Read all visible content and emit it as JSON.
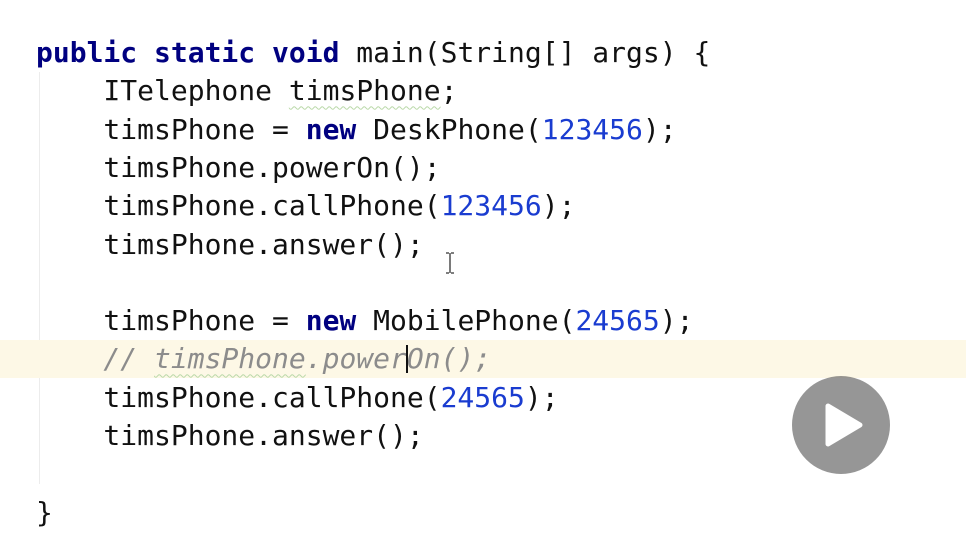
{
  "editor": {
    "lines": [
      {
        "tokens": [
          {
            "t": "public static void",
            "c": "kw"
          },
          {
            "t": " main(String[] args) {",
            "c": "plain"
          }
        ]
      },
      {
        "tokens": [
          {
            "t": "    ITelephone ",
            "c": "plain"
          },
          {
            "t": "timsPhone",
            "c": "plain",
            "u": true
          },
          {
            "t": ";",
            "c": "plain"
          }
        ]
      },
      {
        "tokens": [
          {
            "t": "    timsPhone = ",
            "c": "plain"
          },
          {
            "t": "new",
            "c": "kw"
          },
          {
            "t": " DeskPhone(",
            "c": "plain"
          },
          {
            "t": "123456",
            "c": "num"
          },
          {
            "t": ");",
            "c": "plain"
          }
        ]
      },
      {
        "tokens": [
          {
            "t": "    timsPhone.powerOn();",
            "c": "plain"
          }
        ]
      },
      {
        "tokens": [
          {
            "t": "    timsPhone.callPhone(",
            "c": "plain"
          },
          {
            "t": "123456",
            "c": "num"
          },
          {
            "t": ");",
            "c": "plain"
          }
        ]
      },
      {
        "tokens": [
          {
            "t": "    timsPhone.answer();",
            "c": "plain"
          }
        ]
      },
      {
        "tokens": []
      },
      {
        "tokens": [
          {
            "t": "    timsPhone = ",
            "c": "plain"
          },
          {
            "t": "new",
            "c": "kw"
          },
          {
            "t": " MobilePhone(",
            "c": "plain"
          },
          {
            "t": "24565",
            "c": "num"
          },
          {
            "t": ");",
            "c": "plain"
          }
        ]
      },
      {
        "current": true,
        "tokens": [
          {
            "t": "    // ",
            "c": "comment"
          },
          {
            "t": "timsPhone",
            "c": "comment",
            "u": true
          },
          {
            "t": ".power",
            "c": "comment"
          },
          {
            "caret": true
          },
          {
            "t": "On();",
            "c": "comment"
          }
        ]
      },
      {
        "tokens": [
          {
            "t": "    timsPhone.callPhone(",
            "c": "plain"
          },
          {
            "t": "24565",
            "c": "num"
          },
          {
            "t": ");",
            "c": "plain"
          }
        ]
      },
      {
        "tokens": [
          {
            "t": "    timsPhone.answer();",
            "c": "plain"
          }
        ]
      },
      {
        "tokens": []
      },
      {
        "tokens": [
          {
            "t": "}",
            "c": "plain"
          }
        ]
      }
    ]
  },
  "overlay": {
    "play_icon": "play-icon",
    "cursor_icon": "text-cursor-icon"
  }
}
